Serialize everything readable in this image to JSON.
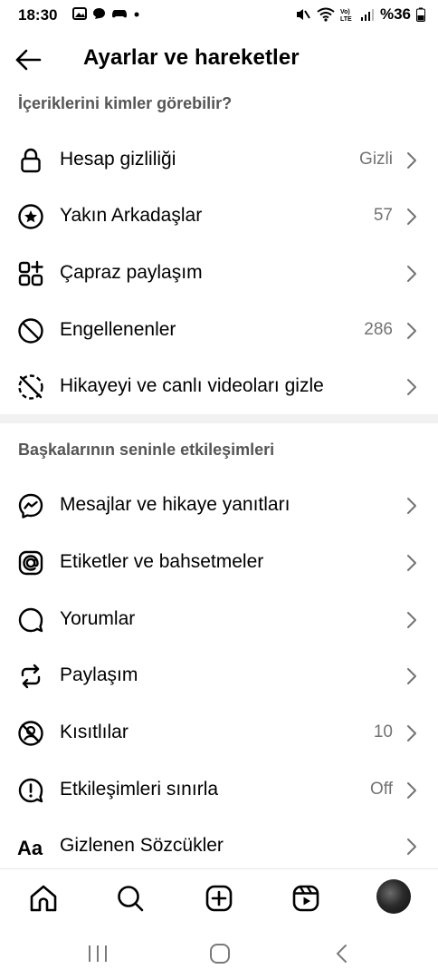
{
  "status_bar": {
    "time": "18:30",
    "battery": "%36"
  },
  "header": {
    "title": "Ayarlar ve hareketler"
  },
  "sections": [
    {
      "title": "İçeriklerini kimler görebilir?",
      "items": [
        {
          "label": "Hesap gizliliği",
          "value": "Gizli",
          "icon": "lock-icon"
        },
        {
          "label": "Yakın Arkadaşlar",
          "value": "57",
          "icon": "star-circle-icon"
        },
        {
          "label": "Çapraz paylaşım",
          "value": "",
          "icon": "apps-add-icon"
        },
        {
          "label": "Engellenenler",
          "value": "286",
          "icon": "blocked-icon"
        },
        {
          "label": "Hikayeyi ve canlı videoları gizle",
          "value": "",
          "icon": "hide-story-icon"
        }
      ]
    },
    {
      "title": "Başkalarının seninle etkileşimleri",
      "items": [
        {
          "label": "Mesajlar ve hikaye yanıtları",
          "value": "",
          "icon": "messenger-icon"
        },
        {
          "label": "Etiketler ve bahsetmeler",
          "value": "",
          "icon": "at-sign-icon"
        },
        {
          "label": "Yorumlar",
          "value": "",
          "icon": "comment-icon"
        },
        {
          "label": "Paylaşım",
          "value": "",
          "icon": "share-icon"
        },
        {
          "label": "Kısıtlılar",
          "value": "10",
          "icon": "restricted-icon"
        },
        {
          "label": "Etkileşimleri sınırla",
          "value": "Off",
          "icon": "limit-icon"
        },
        {
          "label": "Gizlenen Sözcükler",
          "value": "",
          "icon": "text-aa-icon"
        }
      ]
    }
  ],
  "bottom_nav": [
    "home-icon",
    "search-icon",
    "create-icon",
    "reels-icon",
    "profile-avatar"
  ]
}
